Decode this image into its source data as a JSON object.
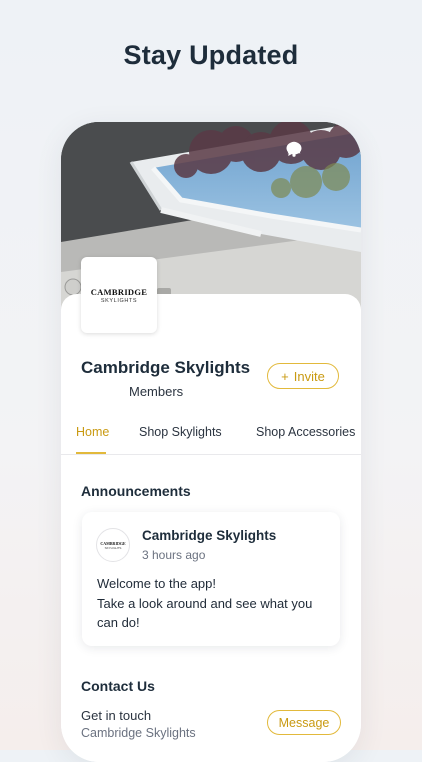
{
  "headline": "Stay Updated",
  "header": {
    "icons": [
      "chat-bubble-icon",
      "bell-icon"
    ]
  },
  "group": {
    "logo_text": "CAMBRIDGE",
    "logo_subtext": "SKYLIGHTS",
    "name": "Cambridge Skylights",
    "members_label": "Members",
    "invite_label": "Invite"
  },
  "tabs": [
    {
      "label": "Home",
      "active": true
    },
    {
      "label": "Shop Skylights",
      "active": false
    },
    {
      "label": "Shop Accessories",
      "active": false
    }
  ],
  "announcements": {
    "title": "Announcements",
    "post": {
      "author": "Cambridge Skylights",
      "time": "3 hours ago",
      "lines": [
        "Welcome to the app!",
        "Take a look around and see what you",
        "can do!"
      ]
    }
  },
  "contact": {
    "title": "Contact Us",
    "line": "Get in touch",
    "sub": "Cambridge Skylights",
    "message_label": "Message"
  },
  "colors": {
    "accent": "#e2b93b",
    "accent_text": "#c99a12",
    "headline": "#1e2d3b"
  }
}
